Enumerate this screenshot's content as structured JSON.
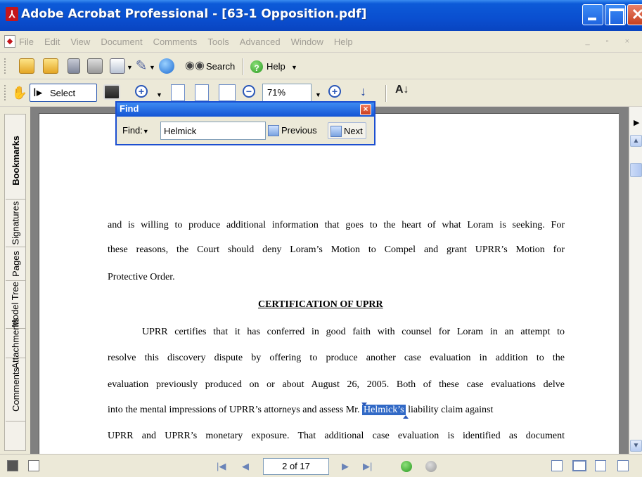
{
  "window": {
    "title": "Adobe Acrobat Professional - [63-1 Opposition.pdf]",
    "close_glyph": "✕"
  },
  "menu": {
    "items": [
      "File",
      "Edit",
      "View",
      "Document",
      "Comments",
      "Tools",
      "Advanced",
      "Window",
      "Help"
    ]
  },
  "toolbar1": {
    "search_label": "Search",
    "help_label": "Help"
  },
  "toolbar2": {
    "select_label": "Select",
    "zoom_value": "71%"
  },
  "find": {
    "title": "Find",
    "find_label": "Find:",
    "query": "Helmick",
    "previous_label": "Previous",
    "next_label": "Next"
  },
  "side_tabs": [
    "Bookmarks",
    "Signatures",
    "Pages",
    "Model Tree",
    "Attachments",
    "Comments"
  ],
  "document": {
    "lines": [
      "and is willing to produce additional information that goes to the heart of what Loram is seeking.  For",
      "these reasons, the Court should deny Loram’s Motion to Compel and grant UPRR’s Motion for",
      "Protective Order."
    ],
    "heading": "CERTIFICATION OF UPRR",
    "para2": [
      "UPRR certifies that it has conferred in good faith with counsel for Loram in an attempt to",
      "resolve this discovery dispute by offering to produce another case evaluation in addition to the",
      "evaluation previously produced on or about August 26, 2005.  Both of these case evaluations delve"
    ],
    "line_hl_before": "into the mental impressions of UPRR’s attorneys and assess Mr. ",
    "line_hl_match": "Helmick’s",
    "line_hl_after": " liability claim against",
    "last_line": "UPRR and UPRR’s monetary exposure.  That additional case evaluation is identified as document"
  },
  "statusbar": {
    "page_counter": "2 of 17"
  },
  "colors": {
    "title_bar": "#0a4fd0",
    "highlight": "#3169c6",
    "doc_bg": "#808080"
  }
}
